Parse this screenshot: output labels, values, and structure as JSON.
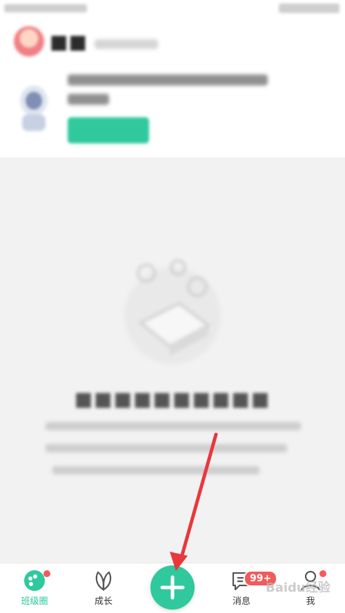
{
  "bottom_nav": {
    "tabs": [
      {
        "label": "班级圈",
        "icon": "class-circle-icon",
        "active": true,
        "dot": true
      },
      {
        "label": "成长",
        "icon": "leaf-icon",
        "active": false
      },
      {
        "label": "消息",
        "icon": "message-icon",
        "active": false,
        "badge": "99+"
      },
      {
        "label": "我",
        "icon": "person-icon",
        "active": false,
        "dot": true
      }
    ],
    "add_icon": "plus-icon"
  },
  "colors": {
    "accent": "#2fc99d",
    "active_tab_text": "#20c997",
    "badge_red": "#f45a5a",
    "arrow_red": "#e8383d"
  },
  "watermark_text": "Baidu经验"
}
